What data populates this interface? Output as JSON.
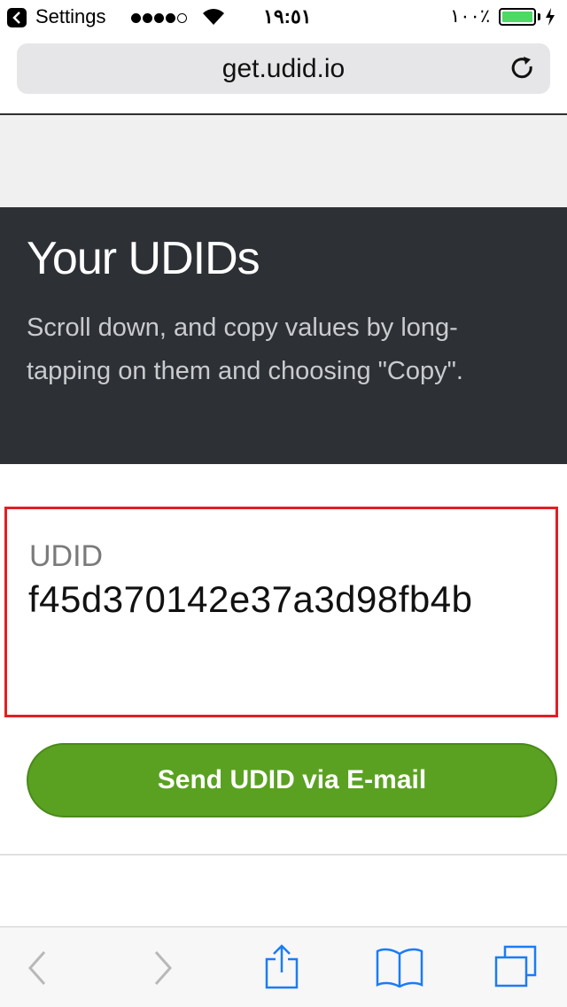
{
  "status_bar": {
    "back_label": "Settings",
    "time": "١٩:٥١",
    "battery_percent": "١٠٠٪",
    "signal_bars": 4,
    "battery_color": "#4cd964"
  },
  "browser": {
    "url": "get.udid.io",
    "reload_icon": "reload-icon"
  },
  "hero": {
    "title": "Your UDIDs",
    "description": "Scroll down, and copy values by long-tapping on them and choosing \"Copy\"."
  },
  "udid": {
    "label": "UDID",
    "value": "f45d370142e37a3d98fb4b",
    "highlight_color": "#e31e24"
  },
  "actions": {
    "email_button_label": "Send UDID via E-mail",
    "button_color": "#5aa121"
  },
  "toolbar": {
    "icons": [
      "back-arrow-icon",
      "forward-arrow-icon",
      "share-icon",
      "bookmarks-icon",
      "tabs-icon"
    ],
    "tint_color": "#1a7cf6"
  }
}
